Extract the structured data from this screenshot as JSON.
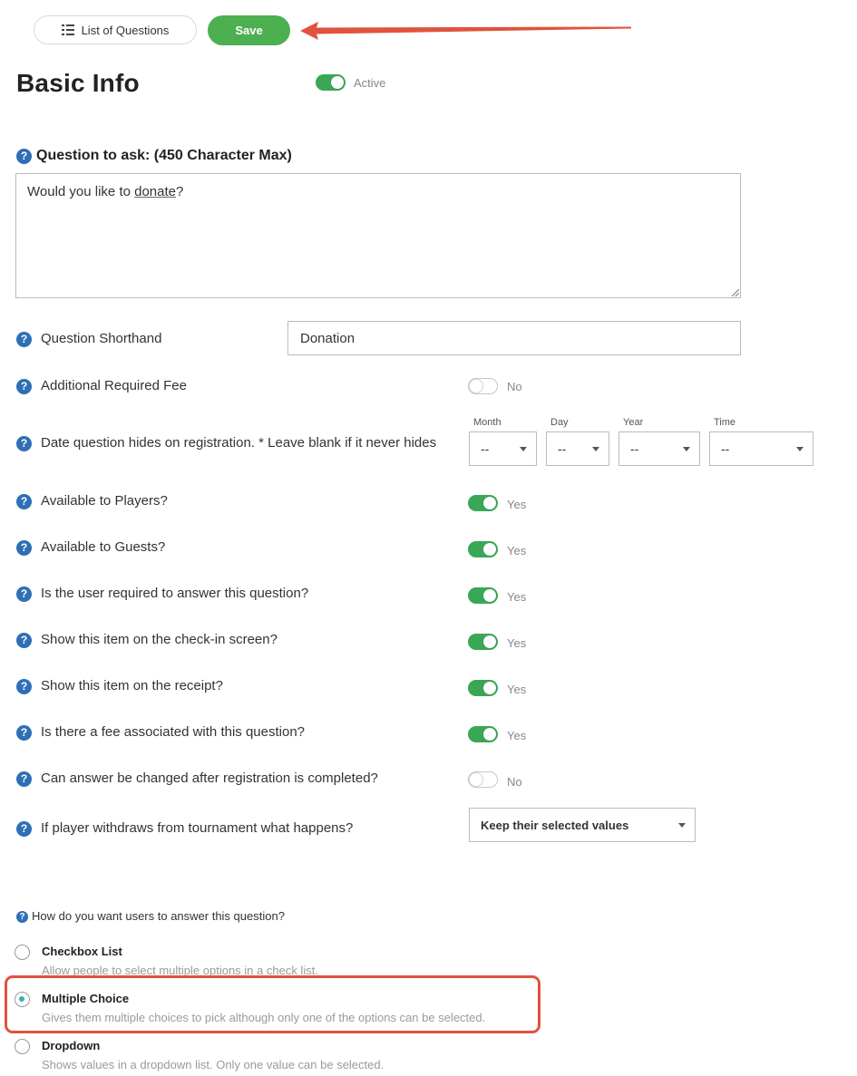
{
  "toolbar": {
    "list_label": "List of Questions",
    "save_label": "Save",
    "arrow_color": "#e0533c",
    "save_color": "#4caf50"
  },
  "header": {
    "title": "Basic Info",
    "active_label": "Active",
    "active_on": true
  },
  "question": {
    "label": "Question to ask: (450 Character Max)",
    "text_before": "Would you like to ",
    "text_underlined": "donate",
    "text_after": "?"
  },
  "shorthand": {
    "label": "Question Shorthand",
    "value": "Donation"
  },
  "fee": {
    "label": "Additional Required Fee",
    "state": "No",
    "on": false
  },
  "date_hide": {
    "label": "Date question hides on registration. * Leave blank if it never hides",
    "month_header": "Month",
    "day_header": "Day",
    "year_header": "Year",
    "time_header": "Time",
    "month_value": "--",
    "day_value": "--",
    "year_value": "--",
    "time_value": "--"
  },
  "settings": [
    {
      "label": "Available to Players?",
      "state": "Yes",
      "on": true
    },
    {
      "label": "Available to Guests?",
      "state": "Yes",
      "on": true
    },
    {
      "label": "Is the user required to answer this question?",
      "state": "Yes",
      "on": true
    },
    {
      "label": "Show this item on the check-in screen?",
      "state": "Yes",
      "on": true
    },
    {
      "label": "Show this item on the receipt?",
      "state": "Yes",
      "on": true
    },
    {
      "label": "Is there a fee associated with this question?",
      "state": "Yes",
      "on": true
    },
    {
      "label": "Can answer be changed after registration is completed?",
      "state": "No",
      "on": false
    }
  ],
  "withdraw": {
    "label": "If player withdraws from tournament what happens?",
    "selected": "Keep their selected values"
  },
  "answer_type": {
    "question": "How do you want users to answer this question?",
    "options": [
      {
        "title": "Checkbox List",
        "desc": "Allow people to select multiple options in a check list.",
        "selected": false
      },
      {
        "title": "Multiple Choice",
        "desc": "Gives them multiple choices to pick although only one of the options can be selected.",
        "selected": true
      },
      {
        "title": "Dropdown",
        "desc": "Shows values in a dropdown list. Only one value can be selected.",
        "selected": false
      }
    ],
    "highlight_color": "#e0533c"
  },
  "icons": {
    "help": "question-mark-icon",
    "list": "list-icon",
    "arrow": "red-arrow-icon",
    "help_glyph": "?"
  }
}
